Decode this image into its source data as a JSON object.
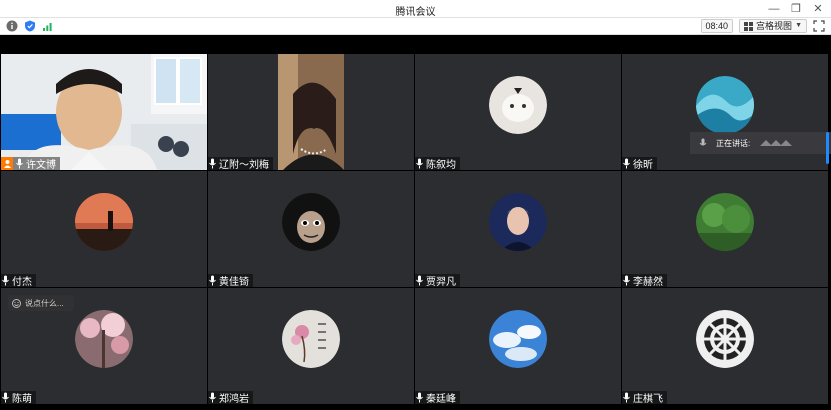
{
  "window": {
    "title": "腾讯会议"
  },
  "toolbar": {
    "time": "08:40",
    "view_label": "宫格视图"
  },
  "participants": [
    {
      "name": "许文博",
      "kind": "video-man",
      "host": true
    },
    {
      "name": "辽附～刘梅",
      "kind": "video-woman"
    },
    {
      "name": "陈叙均",
      "kind": "avatar-cat"
    },
    {
      "name": "徐昕",
      "kind": "avatar-wave"
    },
    {
      "name": "付杰",
      "kind": "avatar-sunset"
    },
    {
      "name": "黄佳锜",
      "kind": "avatar-doll"
    },
    {
      "name": "贾羿凡",
      "kind": "avatar-singer"
    },
    {
      "name": "李赫然",
      "kind": "avatar-forest"
    },
    {
      "name": "陈萌",
      "kind": "avatar-blossom"
    },
    {
      "name": "郑鸿岩",
      "kind": "avatar-flower"
    },
    {
      "name": "秦廷峰",
      "kind": "avatar-clouds"
    },
    {
      "name": "庄棋飞",
      "kind": "avatar-emblem"
    }
  ],
  "speaking": {
    "label": "正在讲话:"
  },
  "chat": {
    "placeholder": "说点什么..."
  },
  "colors": {
    "tile_bg": "#2b2d30",
    "host_badge": "#ff7a00",
    "accent": "#1a8cff"
  }
}
